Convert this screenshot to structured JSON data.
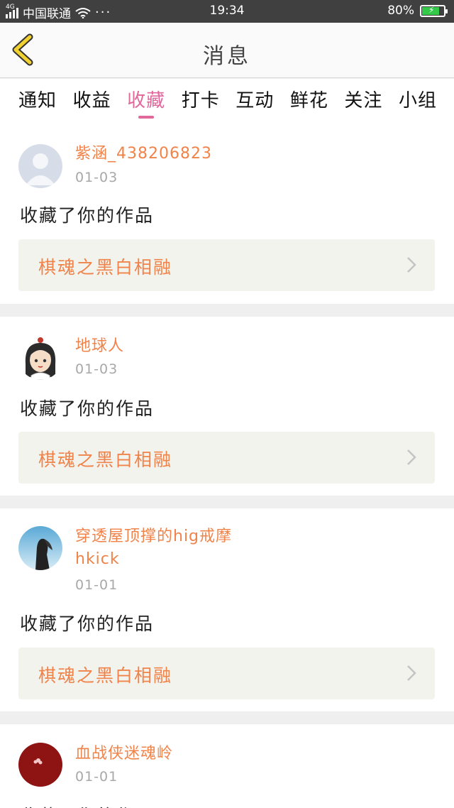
{
  "status_bar": {
    "network": "4G",
    "carrier": "中国联通",
    "more": "···",
    "time": "19:34",
    "battery": "80%",
    "battery_level": 0.8
  },
  "header": {
    "title": "消息",
    "back_icon": "chevron-left-icon"
  },
  "tabs": [
    {
      "label": "通知",
      "active": false
    },
    {
      "label": "收益",
      "active": false
    },
    {
      "label": "收藏",
      "active": true
    },
    {
      "label": "打卡",
      "active": false
    },
    {
      "label": "互动",
      "active": false
    },
    {
      "label": "鲜花",
      "active": false
    },
    {
      "label": "关注",
      "active": false
    },
    {
      "label": "小组",
      "active": false
    }
  ],
  "messages": [
    {
      "user": "紫涵_438206823",
      "date": "01-03",
      "action": "收藏了你的作品",
      "work": "棋魂之黑白相融",
      "avatar": "default-avatar"
    },
    {
      "user": "地球人",
      "date": "01-03",
      "action": "收藏了你的作品",
      "work": "棋魂之黑白相融",
      "avatar": "cartoon-girl-avatar"
    },
    {
      "user": "穿透屋顶撑的hig戒摩hkick",
      "date": "01-01",
      "action": "收藏了你的作品",
      "work": "棋魂之黑白相融",
      "avatar": "sky-photo-avatar"
    },
    {
      "user": "血战侠迷魂岭",
      "date": "01-01",
      "action": "收藏了你的作品",
      "work": "",
      "avatar": "red-flower-avatar"
    }
  ],
  "colors": {
    "accent": "#e0689b",
    "username": "#f0834a",
    "back_icon": "#f2d230",
    "status_bar": "#404040",
    "battery": "#35c94a"
  }
}
